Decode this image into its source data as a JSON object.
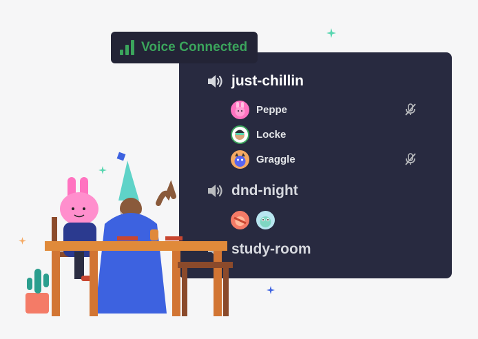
{
  "voice_status": {
    "label": "Voice Connected",
    "color": "#3ba55c"
  },
  "channels": [
    {
      "name": "just-chillin",
      "icon": "speaker-icon",
      "members": [
        {
          "name": "Peppe",
          "avatar_color": "#ff73c0",
          "muted": true
        },
        {
          "name": "Locke",
          "avatar_color": "#3ba55c",
          "muted": false
        },
        {
          "name": "Graggle",
          "avatar_color": "#f5a962",
          "muted": true
        }
      ]
    },
    {
      "name": "dnd-night",
      "icon": "speaker-icon",
      "avatars": [
        {
          "avatar_color": "#f47b67"
        },
        {
          "avatar_color": "#b8e6f0"
        }
      ]
    },
    {
      "name": "study-room",
      "icon": "speaker-icon"
    }
  ],
  "colors": {
    "panel": "#282a40",
    "badge": "#232436",
    "background": "#f6f6f7",
    "accent_green": "#3ba55c"
  }
}
